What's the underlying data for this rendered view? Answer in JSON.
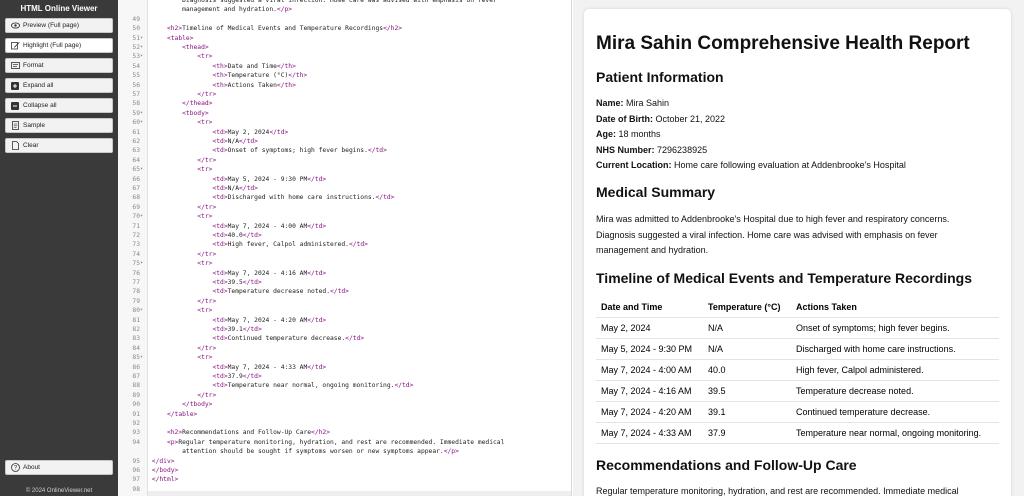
{
  "sidebar": {
    "title": "HTML Online Viewer",
    "buttons": [
      {
        "label": "Preview (Full page)",
        "icon": "eye-icon"
      },
      {
        "label": "Highlight (Full page)",
        "icon": "edit-icon"
      },
      {
        "label": "Format",
        "icon": "format-icon"
      },
      {
        "label": "Expand all",
        "icon": "plus-square-icon"
      },
      {
        "label": "Collapse all",
        "icon": "minus-square-icon"
      },
      {
        "label": "Sample",
        "icon": "document-icon"
      },
      {
        "label": "Clear",
        "icon": "blank-page-icon"
      }
    ],
    "about_label": "About",
    "copyright": "© 2024 OnlineViewer.net"
  },
  "editor": {
    "lines": [
      {
        "n": "",
        "fold": false,
        "indent": 2,
        "text": "Diagnosis suggested a viral infection. Home care was advised with emphasis on fever"
      },
      {
        "n": "",
        "fold": false,
        "indent": 2,
        "text": "management and hydration.</p>"
      },
      {
        "n": "49",
        "fold": false,
        "indent": 0,
        "text": ""
      },
      {
        "n": "50",
        "fold": false,
        "indent": 1,
        "text": "<h2>Timeline of Medical Events and Temperature Recordings</h2>"
      },
      {
        "n": "51",
        "fold": true,
        "indent": 1,
        "text": "<table>"
      },
      {
        "n": "52",
        "fold": true,
        "indent": 2,
        "text": "<thead>"
      },
      {
        "n": "53",
        "fold": true,
        "indent": 3,
        "text": "<tr>"
      },
      {
        "n": "54",
        "fold": false,
        "indent": 4,
        "text": "<th>Date and Time</th>"
      },
      {
        "n": "55",
        "fold": false,
        "indent": 4,
        "text": "<th>Temperature (°C)</th>"
      },
      {
        "n": "56",
        "fold": false,
        "indent": 4,
        "text": "<th>Actions Taken</th>"
      },
      {
        "n": "57",
        "fold": false,
        "indent": 3,
        "text": "</tr>"
      },
      {
        "n": "58",
        "fold": false,
        "indent": 2,
        "text": "</thead>"
      },
      {
        "n": "59",
        "fold": true,
        "indent": 2,
        "text": "<tbody>"
      },
      {
        "n": "60",
        "fold": true,
        "indent": 3,
        "text": "<tr>"
      },
      {
        "n": "61",
        "fold": false,
        "indent": 4,
        "text": "<td>May 2, 2024</td>"
      },
      {
        "n": "62",
        "fold": false,
        "indent": 4,
        "text": "<td>N/A</td>"
      },
      {
        "n": "63",
        "fold": false,
        "indent": 4,
        "text": "<td>Onset of symptoms; high fever begins.</td>"
      },
      {
        "n": "64",
        "fold": false,
        "indent": 3,
        "text": "</tr>"
      },
      {
        "n": "65",
        "fold": true,
        "indent": 3,
        "text": "<tr>"
      },
      {
        "n": "66",
        "fold": false,
        "indent": 4,
        "text": "<td>May 5, 2024 - 9:30 PM</td>"
      },
      {
        "n": "67",
        "fold": false,
        "indent": 4,
        "text": "<td>N/A</td>"
      },
      {
        "n": "68",
        "fold": false,
        "indent": 4,
        "text": "<td>Discharged with home care instructions.</td>"
      },
      {
        "n": "69",
        "fold": false,
        "indent": 3,
        "text": "</tr>"
      },
      {
        "n": "70",
        "fold": true,
        "indent": 3,
        "text": "<tr>"
      },
      {
        "n": "71",
        "fold": false,
        "indent": 4,
        "text": "<td>May 7, 2024 - 4:00 AM</td>"
      },
      {
        "n": "72",
        "fold": false,
        "indent": 4,
        "text": "<td>40.0</td>"
      },
      {
        "n": "73",
        "fold": false,
        "indent": 4,
        "text": "<td>High fever, Calpol administered.</td>"
      },
      {
        "n": "74",
        "fold": false,
        "indent": 3,
        "text": "</tr>"
      },
      {
        "n": "75",
        "fold": true,
        "indent": 3,
        "text": "<tr>"
      },
      {
        "n": "76",
        "fold": false,
        "indent": 4,
        "text": "<td>May 7, 2024 - 4:16 AM</td>"
      },
      {
        "n": "77",
        "fold": false,
        "indent": 4,
        "text": "<td>39.5</td>"
      },
      {
        "n": "78",
        "fold": false,
        "indent": 4,
        "text": "<td>Temperature decrease noted.</td>"
      },
      {
        "n": "79",
        "fold": false,
        "indent": 3,
        "text": "</tr>"
      },
      {
        "n": "80",
        "fold": true,
        "indent": 3,
        "text": "<tr>"
      },
      {
        "n": "81",
        "fold": false,
        "indent": 4,
        "text": "<td>May 7, 2024 - 4:20 AM</td>"
      },
      {
        "n": "82",
        "fold": false,
        "indent": 4,
        "text": "<td>39.1</td>"
      },
      {
        "n": "83",
        "fold": false,
        "indent": 4,
        "text": "<td>Continued temperature decrease.</td>"
      },
      {
        "n": "84",
        "fold": false,
        "indent": 3,
        "text": "</tr>"
      },
      {
        "n": "85",
        "fold": true,
        "indent": 3,
        "text": "<tr>"
      },
      {
        "n": "86",
        "fold": false,
        "indent": 4,
        "text": "<td>May 7, 2024 - 4:33 AM</td>"
      },
      {
        "n": "87",
        "fold": false,
        "indent": 4,
        "text": "<td>37.9</td>"
      },
      {
        "n": "88",
        "fold": false,
        "indent": 4,
        "text": "<td>Temperature near normal, ongoing monitoring.</td>"
      },
      {
        "n": "89",
        "fold": false,
        "indent": 3,
        "text": "</tr>"
      },
      {
        "n": "90",
        "fold": false,
        "indent": 2,
        "text": "</tbody>"
      },
      {
        "n": "91",
        "fold": false,
        "indent": 1,
        "text": "</table>"
      },
      {
        "n": "92",
        "fold": false,
        "indent": 0,
        "text": ""
      },
      {
        "n": "93",
        "fold": false,
        "indent": 1,
        "text": "<h2>Recommendations and Follow-Up Care</h2>"
      },
      {
        "n": "94",
        "fold": false,
        "indent": 1,
        "text": "<p>Regular temperature monitoring, hydration, and rest are recommended. Immediate medical"
      },
      {
        "n": "",
        "fold": false,
        "indent": 2,
        "text": "attention should be sought if symptoms worsen or new symptoms appear.</p>"
      },
      {
        "n": "95",
        "fold": false,
        "indent": 0,
        "text": "</div>"
      },
      {
        "n": "96",
        "fold": false,
        "indent": 0,
        "text": "</body>"
      },
      {
        "n": "97",
        "fold": false,
        "indent": 0,
        "text": "</html>"
      },
      {
        "n": "98",
        "fold": false,
        "indent": 0,
        "text": ""
      }
    ]
  },
  "preview": {
    "title": "Mira Sahin Comprehensive Health Report",
    "patient_heading": "Patient Information",
    "patient_fields": [
      {
        "label": "Name:",
        "value": "Mira Sahin"
      },
      {
        "label": "Date of Birth:",
        "value": "October 21, 2022"
      },
      {
        "label": "Age:",
        "value": "18 months"
      },
      {
        "label": "NHS Number:",
        "value": "7296238925"
      },
      {
        "label": "Current Location:",
        "value": "Home care following evaluation at Addenbrooke's Hospital"
      }
    ],
    "summary_heading": "Medical Summary",
    "summary_lines": [
      "Mira was admitted to Addenbrooke's Hospital due to high fever and respiratory concerns.",
      "Diagnosis suggested a viral infection. Home care was advised with emphasis on fever",
      "management and hydration."
    ],
    "timeline_heading": "Timeline of Medical Events and Temperature Recordings",
    "table_headers": [
      "Date and Time",
      "Temperature (°C)",
      "Actions Taken"
    ],
    "table_rows": [
      [
        "May 2, 2024",
        "N/A",
        "Onset of symptoms; high fever begins."
      ],
      [
        "May 5, 2024 - 9:30 PM",
        "N/A",
        "Discharged with home care instructions."
      ],
      [
        "May 7, 2024 - 4:00 AM",
        "40.0",
        "High fever, Calpol administered."
      ],
      [
        "May 7, 2024 - 4:16 AM",
        "39.5",
        "Temperature decrease noted."
      ],
      [
        "May 7, 2024 - 4:20 AM",
        "39.1",
        "Continued temperature decrease."
      ],
      [
        "May 7, 2024 - 4:33 AM",
        "37.9",
        "Temperature near normal, ongoing monitoring."
      ]
    ],
    "recommendations_heading": "Recommendations and Follow-Up Care",
    "recommendations_text": "Regular temperature monitoring, hydration, and rest are recommended. Immediate medical"
  },
  "colors": {
    "sidebar_bg": "#3a3a3a",
    "tag_color": "#881280",
    "preview_bg": "#f2f2f2"
  }
}
